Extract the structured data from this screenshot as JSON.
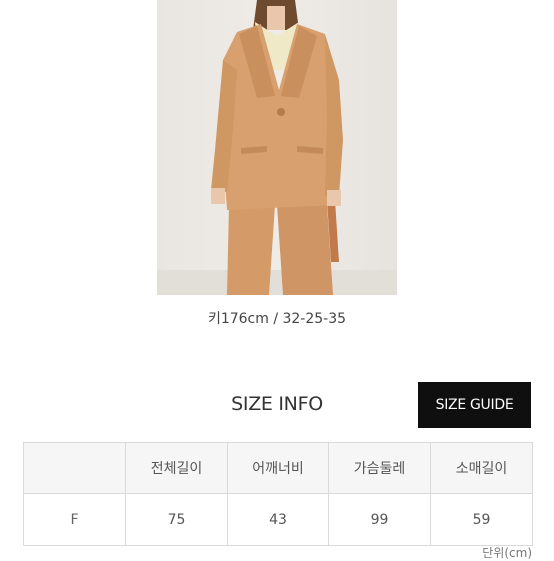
{
  "product": {
    "image_alt": "model wearing camel blazer and trousers",
    "caption": "키176cm / 32-25-35"
  },
  "size_info": {
    "title": "SIZE INFO",
    "guide_button": "SIZE GUIDE",
    "columns": [
      "",
      "전체길이",
      "어깨너비",
      "가슴둘레",
      "소매길이"
    ],
    "rows": [
      [
        "F",
        "75",
        "43",
        "99",
        "59"
      ]
    ],
    "unit": "단위(cm)"
  },
  "colors": {
    "blazer": "#d7a06e",
    "button_bg": "#0f0f0f",
    "table_border": "#d9d9d9"
  }
}
